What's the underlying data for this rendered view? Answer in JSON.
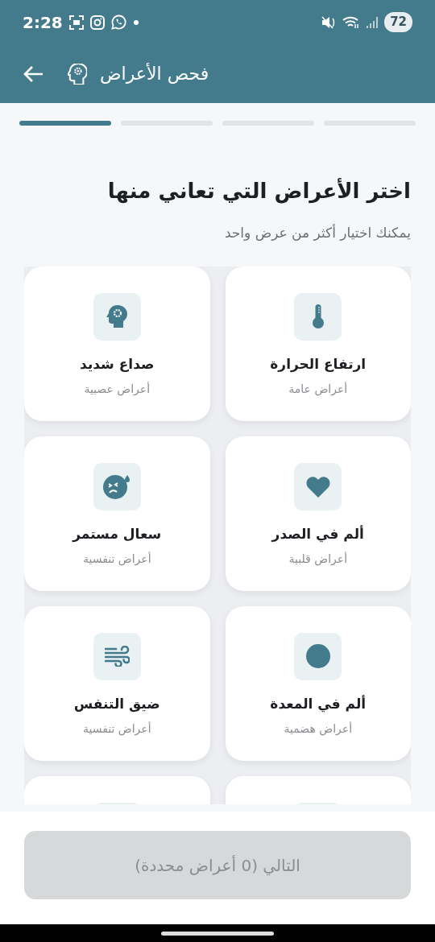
{
  "status_bar": {
    "time": "2:28",
    "battery": "72"
  },
  "header": {
    "title": "فحص الأعراض"
  },
  "progress_steps": [
    {
      "active": true
    },
    {
      "active": false
    },
    {
      "active": false
    },
    {
      "active": false
    }
  ],
  "heading": "اختر الأعراض التي تعاني منها",
  "subheading": "يمكنك اختيار أكثر من عرض واحد",
  "symptoms": [
    {
      "kind": "thermometer",
      "name": "ارتفاع الحرارة",
      "category": "أعراض عامة",
      "selected": false
    },
    {
      "kind": "head",
      "name": "صداع شديد",
      "category": "أعراض عصبية",
      "selected": false
    },
    {
      "kind": "heart",
      "name": "ألم في الصدر",
      "category": "أعراض قلبية",
      "selected": false
    },
    {
      "kind": "face",
      "name": "سعال مستمر",
      "category": "أعراض تنفسية",
      "selected": false
    },
    {
      "kind": "circle",
      "name": "ألم في المعدة",
      "category": "أعراض هضمية",
      "selected": false
    },
    {
      "kind": "wind",
      "name": "ضيق التنفس",
      "category": "أعراض تنفسية",
      "selected": false
    },
    {
      "kind": "cut"
    },
    {
      "kind": "cut"
    }
  ],
  "next_button": {
    "label": "التالي (0 أعراض محددة)",
    "disabled": true
  }
}
